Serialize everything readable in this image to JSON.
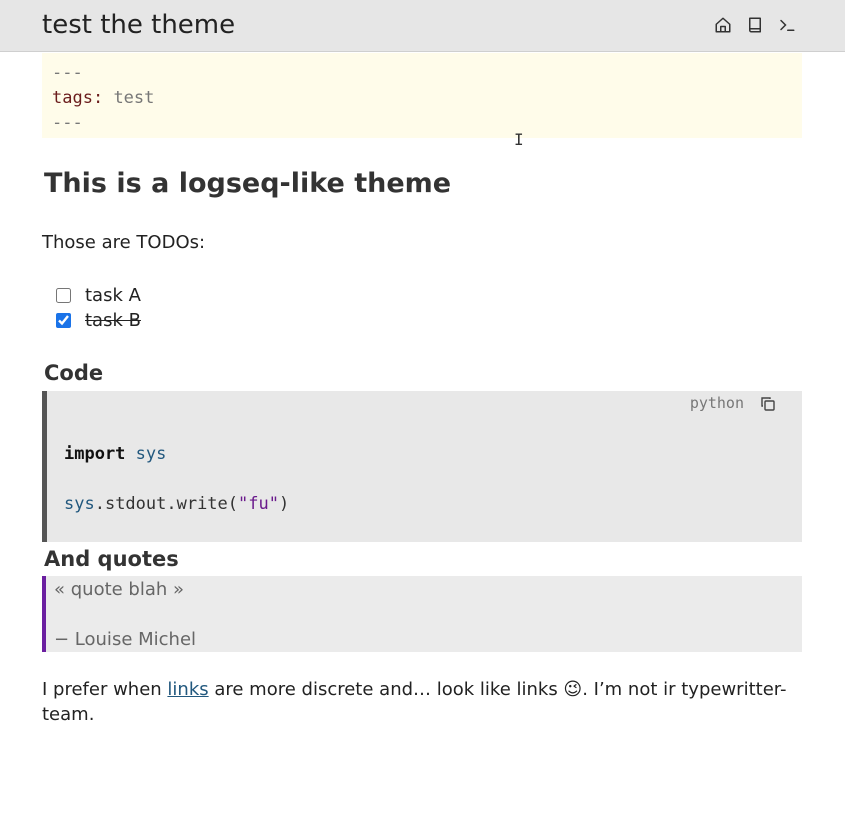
{
  "header": {
    "title": "test the theme",
    "icons": [
      "home-icon",
      "book-icon",
      "terminal-icon"
    ]
  },
  "frontmatter": {
    "dash": "---",
    "key": "tags:",
    "value": "test"
  },
  "page": {
    "heading": "This is a logseq-like theme",
    "intro": "Those are TODOs:"
  },
  "todos": [
    {
      "label": "task A",
      "checked": false
    },
    {
      "label": "task B",
      "checked": true
    }
  ],
  "code_section": {
    "heading": "Code",
    "language": "python",
    "line1_kw": "import",
    "line1_mod": "sys",
    "line2_mod": "sys",
    "line2_rest": ".stdout.write(",
    "line2_str": "\"fu\"",
    "line2_close": ")"
  },
  "quotes_section": {
    "heading": "And quotes",
    "quote_text": "«  quote blah »",
    "author": "− Louise Michel"
  },
  "footer": {
    "before_link": "I prefer when ",
    "link_text": "links",
    "after_link": " are more discrete and… look like links 😉. I’m not ir typewritter-team."
  },
  "colors": {
    "accent_link": "#22587e",
    "quote_border": "#6b1fa0",
    "frontmatter_bg": "#fffcea"
  }
}
